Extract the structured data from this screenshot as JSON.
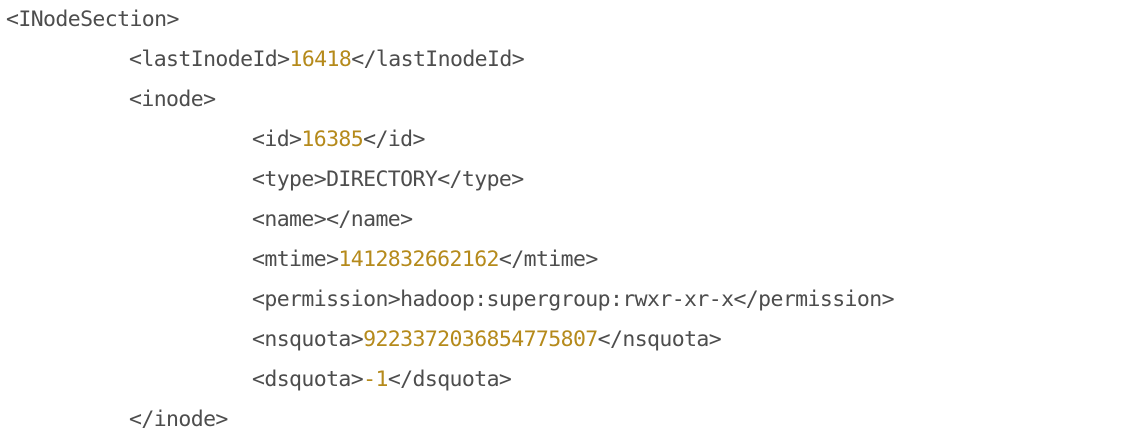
{
  "code": {
    "inode_section_open": "<INodeSection>",
    "last_inode_id": {
      "open": "<lastInodeId>",
      "value": "16418",
      "close": "</lastInodeId>"
    },
    "inode_open": "<inode>",
    "id": {
      "open": "<id>",
      "value": "16385",
      "close": "</id>"
    },
    "type": {
      "open": "<type>",
      "value": "DIRECTORY",
      "close": "</type>"
    },
    "name": {
      "open": "<name>",
      "close": "</name>"
    },
    "mtime": {
      "open": "<mtime>",
      "value": "1412832662162",
      "close": "</mtime>"
    },
    "permission": {
      "open": "<permission>",
      "value": "hadoop:supergroup:rwxr-xr-x",
      "close": "</permission>"
    },
    "nsquota": {
      "open": "<nsquota>",
      "value": "9223372036854775807",
      "close": "</nsquota>"
    },
    "dsquota": {
      "open": "<dsquota>",
      "value": "-1",
      "close": "</dsquota>"
    },
    "inode_close": "</inode>"
  },
  "colors": {
    "text": "#4d4d4d",
    "number": "#b58a1b",
    "background": "#ffffff"
  }
}
